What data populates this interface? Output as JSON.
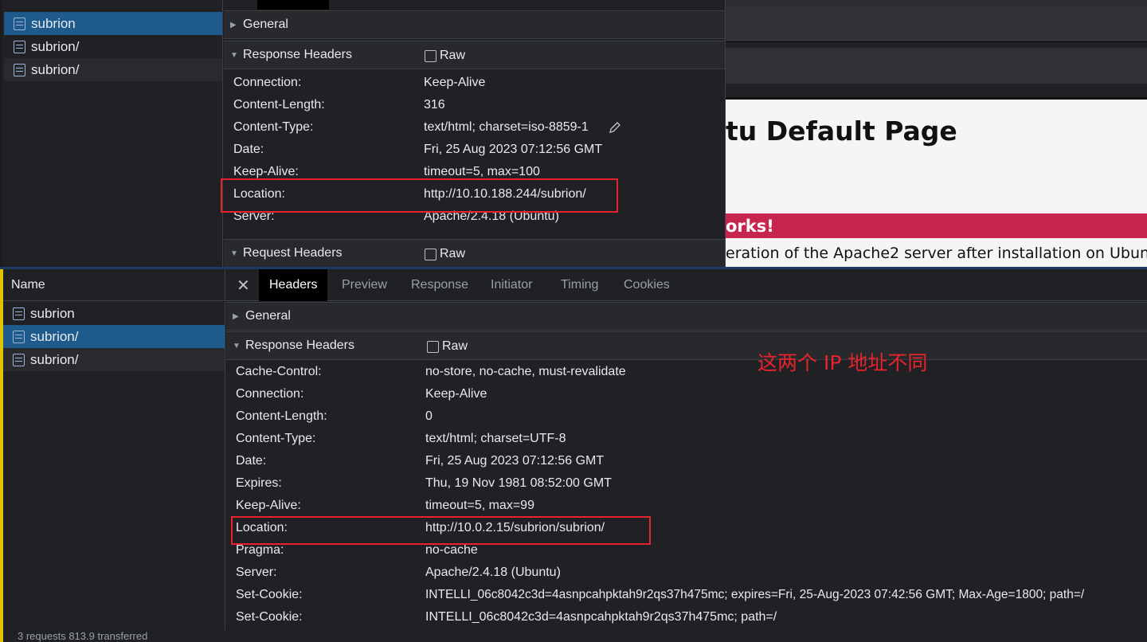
{
  "top": {
    "name_rows": [
      {
        "label": "subrion",
        "selected": true
      },
      {
        "label": "subrion/",
        "selected": false
      },
      {
        "label": "subrion/",
        "selected": false
      }
    ],
    "sections": {
      "general": "General",
      "response_headers": "Response Headers",
      "request_headers": "Request Headers",
      "raw": "Raw"
    },
    "headers": [
      {
        "key": "Connection:",
        "value": "Keep-Alive"
      },
      {
        "key": "Content-Length:",
        "value": "316"
      },
      {
        "key": "Content-Type:",
        "value": "text/html; charset=iso-8859-1"
      },
      {
        "key": "Date:",
        "value": "Fri, 25 Aug 2023 07:12:56 GMT"
      },
      {
        "key": "Keep-Alive:",
        "value": "timeout=5, max=100"
      },
      {
        "key": "Location:",
        "value": "http://10.10.188.244/subrion/"
      },
      {
        "key": "Server:",
        "value": "Apache/2.4.18 (Ubuntu)"
      }
    ],
    "apache_page": {
      "title": "tu Default Page",
      "banner": "orks!",
      "paragraph": "eration of the Apache2 server after installation on Ubuntu"
    }
  },
  "bottom": {
    "name_header": "Name",
    "tabs": [
      "Headers",
      "Preview",
      "Response",
      "Initiator",
      "Timing",
      "Cookies"
    ],
    "active_tab": "Headers",
    "name_rows": [
      {
        "label": "subrion",
        "selected": false
      },
      {
        "label": "subrion/",
        "selected": true
      },
      {
        "label": "subrion/",
        "selected": false
      }
    ],
    "sections": {
      "general": "General",
      "response_headers": "Response Headers",
      "raw": "Raw"
    },
    "headers": [
      {
        "key": "Cache-Control:",
        "value": "no-store, no-cache, must-revalidate"
      },
      {
        "key": "Connection:",
        "value": "Keep-Alive"
      },
      {
        "key": "Content-Length:",
        "value": "0"
      },
      {
        "key": "Content-Type:",
        "value": "text/html; charset=UTF-8"
      },
      {
        "key": "Date:",
        "value": "Fri, 25 Aug 2023 07:12:56 GMT"
      },
      {
        "key": "Expires:",
        "value": "Thu, 19 Nov 1981 08:52:00 GMT"
      },
      {
        "key": "Keep-Alive:",
        "value": "timeout=5, max=99"
      },
      {
        "key": "Location:",
        "value": "http://10.0.2.15/subrion/subrion/"
      },
      {
        "key": "Pragma:",
        "value": "no-cache"
      },
      {
        "key": "Server:",
        "value": "Apache/2.4.18 (Ubuntu)"
      },
      {
        "key": "Set-Cookie:",
        "value": "INTELLI_06c8042c3d=4asnpcahpktah9r2qs37h475mc; expires=Fri, 25-Aug-2023 07:42:56 GMT; Max-Age=1800; path=/"
      },
      {
        "key": "Set-Cookie:",
        "value": "INTELLI_06c8042c3d=4asnpcahpktah9r2qs37h475mc; path=/"
      }
    ],
    "annotation": "这两个 IP 地址不同",
    "status": "3 requests   813.9 transferred"
  },
  "colors": {
    "highlight": "#e8232e",
    "selected_row": "#1e5b8c",
    "banner": "#c7254e"
  }
}
